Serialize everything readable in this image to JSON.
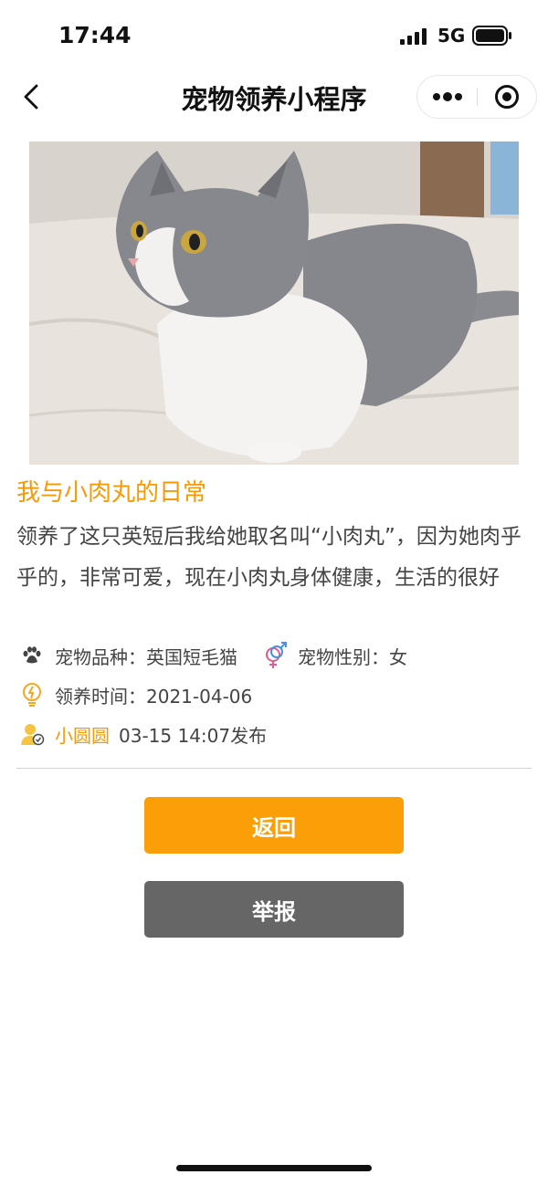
{
  "status_bar": {
    "time": "17:44",
    "network": "5G",
    "icons": [
      "signal-icon",
      "battery-icon"
    ]
  },
  "nav": {
    "title": "宠物领养小程序",
    "icons": [
      "back-arrow-icon",
      "more-dots-icon",
      "target-icon"
    ]
  },
  "post": {
    "image_desc": "grey-and-white british shorthair cat lying on bed",
    "title": "我与小肉丸的日常",
    "description": "领养了这只英短后我给她取名叫“小肉丸”，因为她肉乎乎的，非常可爱，现在小肉丸身体健康，生活的很好",
    "breed_label": "宠物品种：英国短毛猫",
    "gender_label": "宠物性别：女",
    "adopt_time_label": "领养时间：2021-04-06",
    "author": "小圆圆",
    "publish_time": "03-15 14:07发布"
  },
  "buttons": {
    "back": "返回",
    "report": "举报"
  },
  "colors": {
    "accent": "#f59a06",
    "back_button": "#fb9f08",
    "report_button": "#666666"
  }
}
